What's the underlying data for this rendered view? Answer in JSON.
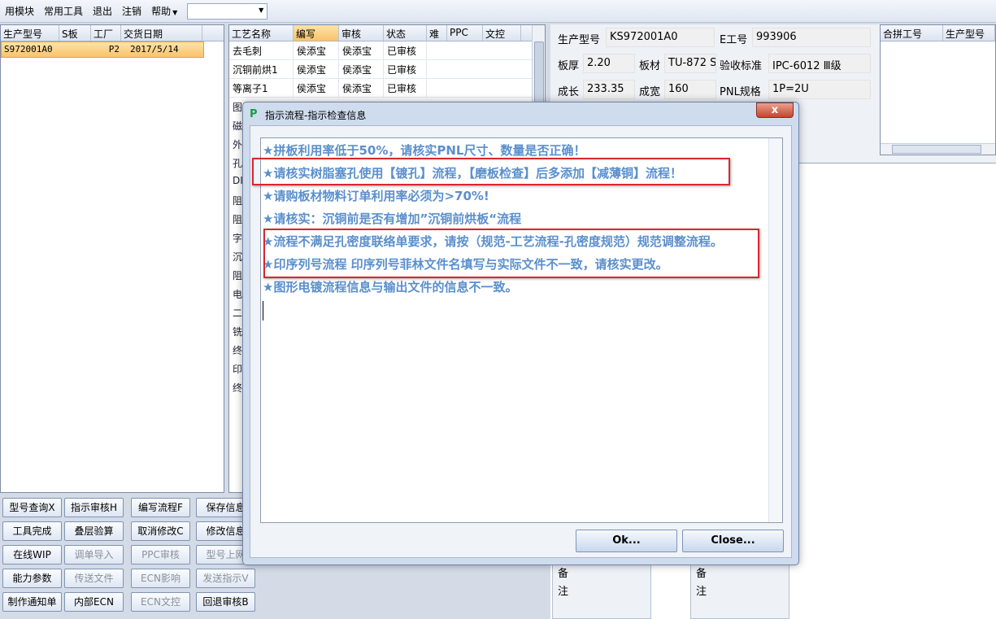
{
  "menu": {
    "items": [
      "用模块",
      "常用工具",
      "退出",
      "注销",
      "帮助"
    ],
    "combo_value": ""
  },
  "orders": {
    "headers": [
      "生产型号",
      "S板",
      "工厂",
      "交货日期"
    ],
    "rows": [
      {
        "model": "S972001A0",
        "s": "",
        "factory": "P2",
        "date": "2017/5/14"
      }
    ]
  },
  "process": {
    "headers": [
      "工艺名称",
      "编写",
      "审核",
      "状态",
      "难",
      "PPC",
      "文控"
    ],
    "rows": [
      {
        "name": "去毛刺",
        "writer": "侯添宝",
        "reviewer": "侯添宝",
        "status": "已审核"
      },
      {
        "name": "沉铜前烘1",
        "writer": "侯添宝",
        "reviewer": "侯添宝",
        "status": "已审核"
      },
      {
        "name": "等离子1",
        "writer": "侯添宝",
        "reviewer": "侯添宝",
        "status": "已审核"
      }
    ],
    "lower_labels": [
      "图",
      "磁",
      "外",
      "孔",
      "DI",
      "阻",
      "阻",
      "字",
      "沉",
      "阻",
      "电",
      "二",
      "铣",
      "终",
      "印",
      "终"
    ]
  },
  "info": {
    "model_label": "生产型号",
    "model_value": "KS972001A0",
    "eno_label": "E工号",
    "eno_value": "993906",
    "thick_label": "板厚",
    "thick_value": "2.20",
    "material_label": "板材",
    "material_value": "TU-872 S",
    "standard_label": "验收标准",
    "standard_value": "IPC-6012 Ⅲ级",
    "length_label": "成长",
    "length_value": "233.35",
    "width_label": "成宽",
    "width_value": "160",
    "pnl_label": "PNL规格",
    "pnl_value": "1P=2U"
  },
  "merge": {
    "headers": [
      "合拼工号",
      "生产型号"
    ]
  },
  "notes": {
    "label1": "备\n注",
    "label2": "备\n注"
  },
  "buttons": [
    {
      "label": "型号查询X",
      "disabled": false
    },
    {
      "label": "指示审核H",
      "disabled": false
    },
    {
      "label": "编写流程F",
      "disabled": false
    },
    {
      "label": "保存信息",
      "disabled": false
    },
    {
      "label": "工具完成",
      "disabled": false
    },
    {
      "label": "叠层验算",
      "disabled": false
    },
    {
      "label": "取消修改C",
      "disabled": false
    },
    {
      "label": "修改信息",
      "disabled": false
    },
    {
      "label": "在线WIP",
      "disabled": false
    },
    {
      "label": "调单导入",
      "disabled": true
    },
    {
      "label": "PPC审核",
      "disabled": true
    },
    {
      "label": "型号上网",
      "disabled": true
    },
    {
      "label": "能力参数",
      "disabled": false
    },
    {
      "label": "传送文件",
      "disabled": true
    },
    {
      "label": "ECN影响",
      "disabled": true
    },
    {
      "label": "发送指示V",
      "disabled": true
    },
    {
      "label": "制作通知单",
      "disabled": false
    },
    {
      "label": "内部ECN",
      "disabled": false
    },
    {
      "label": "ECN文控",
      "disabled": true
    },
    {
      "label": "回退审核B",
      "disabled": false
    }
  ],
  "dialog": {
    "title": "指示流程-指示检查信息",
    "close_glyph": "x",
    "messages": [
      "★拼板利用率低于50%，请核实PNL尺寸、数量是否正确！",
      "★请核实树脂塞孔使用【镀孔】流程，【磨板检查】后多添加【减薄铜】流程！",
      "★请购板材物料订单利用率必须为>70%!",
      "★请核实：沉铜前是否有增加”沉铜前烘板“流程",
      "★流程不满足孔密度联络单要求，请按（规范-工艺流程-孔密度规范）规范调整流程。",
      "★印序列号流程 印序列号菲林文件名填写与实际文件不一致，请核实更改。",
      "★图形电镀流程信息与输出文件的信息不一致。"
    ],
    "ok_label": "Ok...",
    "close_label": "Close..."
  },
  "colors": {
    "message_text": "#5a8fcd",
    "highlight": "#d9262f",
    "selected_row": "#f9c36b"
  }
}
